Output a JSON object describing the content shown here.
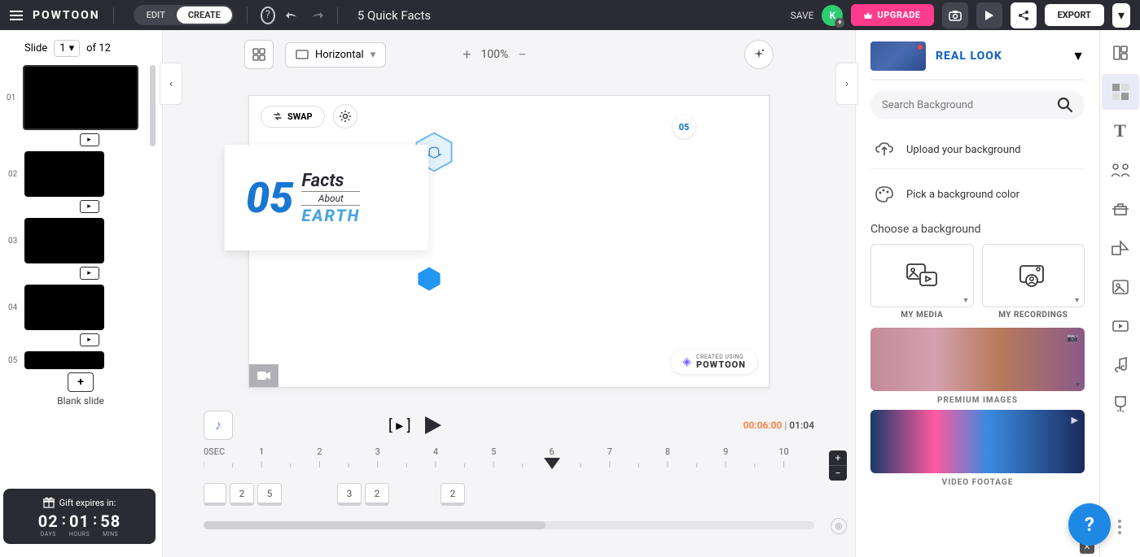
{
  "header": {
    "logo": "POWTOON",
    "edit_label": "EDIT",
    "create_label": "CREATE",
    "title": "5 Quick Facts",
    "save_label": "SAVE",
    "avatar_initial": "K",
    "upgrade_label": "UPGRADE",
    "export_label": "EXPORT"
  },
  "slides": {
    "label": "Slide",
    "current": "1",
    "of_label": "of 12",
    "items": [
      {
        "idx": "01"
      },
      {
        "idx": "02"
      },
      {
        "idx": "03"
      },
      {
        "idx": "04"
      },
      {
        "idx": "05"
      }
    ],
    "blank_label": "Blank slide"
  },
  "gift": {
    "heading": "Gift expires in:",
    "days_val": "02",
    "days_lbl": "DAYS",
    "hours_val": "01",
    "hours_lbl": "HOURS",
    "mins_val": "58",
    "mins_lbl": "MINS"
  },
  "toolbar": {
    "orientation": "Horizontal",
    "zoom": "100%",
    "swap_label": "SWAP"
  },
  "stage": {
    "badge": "05",
    "big_number": "05",
    "facts": "Facts",
    "about": "About",
    "earth": "EARTH",
    "watermark_top": "CREATED USING",
    "watermark_bot": "POWTOON"
  },
  "timeline": {
    "zero": "0SEC",
    "marks": [
      "1",
      "2",
      "3",
      "4",
      "5",
      "6",
      "7",
      "8",
      "9",
      "10"
    ],
    "current_time": "00:06:00",
    "total_time": "01:04",
    "clips_a": [
      "",
      "2",
      "5"
    ],
    "clips_b": [
      "3",
      "2"
    ],
    "clips_c": [
      "2"
    ]
  },
  "right": {
    "theme_name": "REAL LOOK",
    "search_placeholder": "Search Background",
    "upload_label": "Upload your background",
    "color_label": "Pick a background color",
    "choose_label": "Choose a background",
    "my_media": "MY MEDIA",
    "my_recordings": "MY RECORDINGS",
    "premium_images": "PREMIUM IMAGES",
    "video_footage": "VIDEO FOOTAGE"
  }
}
